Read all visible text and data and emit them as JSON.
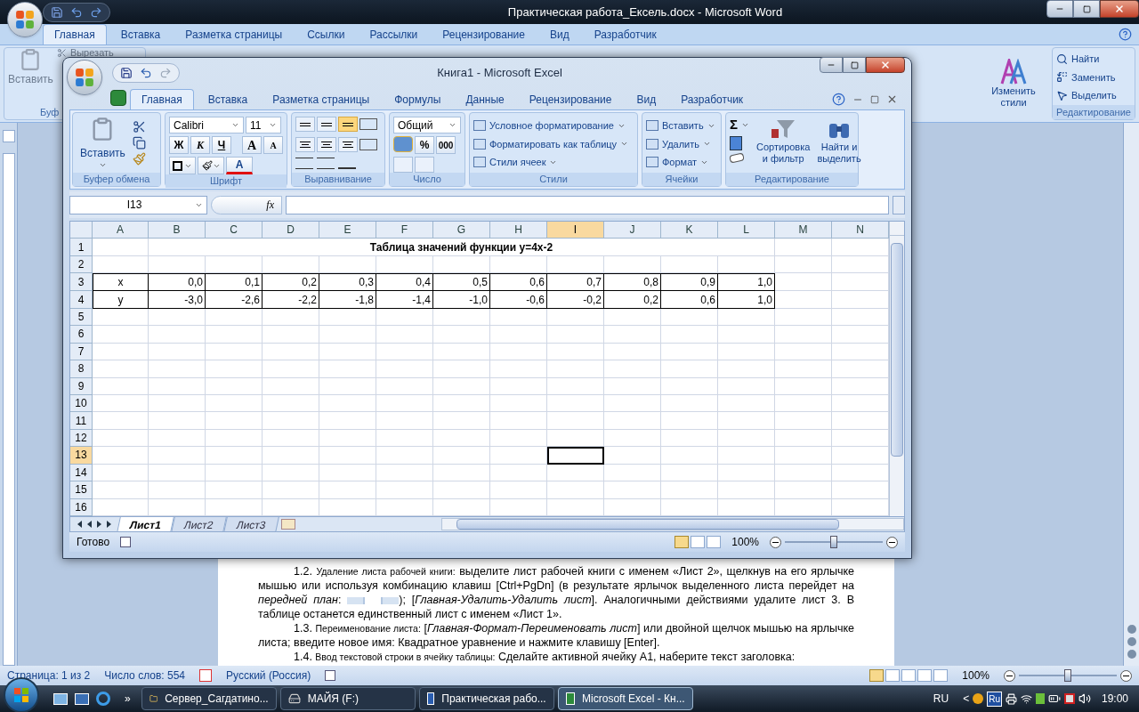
{
  "word": {
    "title": "Практическая работа_Ексель.docx - Microsoft Word",
    "tabs": [
      {
        "label": "Главная",
        "selected": true
      },
      {
        "label": "Вставка",
        "selected": false
      },
      {
        "label": "Разметка страницы",
        "selected": false
      },
      {
        "label": "Ссылки",
        "selected": false
      },
      {
        "label": "Рассылки",
        "selected": false
      },
      {
        "label": "Рецензирование",
        "selected": false
      },
      {
        "label": "Вид",
        "selected": false
      },
      {
        "label": "Разработчик",
        "selected": false
      }
    ],
    "ribbon": {
      "paste": "Вставить",
      "cut": "Вырезать",
      "clipboard_group": "Буф",
      "change_styles": [
        "Изменить",
        "стили"
      ],
      "editing": [
        "Найти",
        "Заменить",
        "Выделить"
      ],
      "editing_group": "Редактирование"
    },
    "paragraphs": [
      {
        "number": "1.2.",
        "heading": "Удаление листа рабочей книги:",
        "text": "выделите лист рабочей книги с именем «Лист 2», щелкнув на его ярлычке мышью или используя комбинацию клавиш [Ctrl+PgDn] (в результате ярлычок выделенного листа перейдет на *передней план*:",
        "text_after": "); [*Главная-Удалить-Удалить лист*]. Аналогичными действиями удалите лист 3. В таблице останется единственный лист с именем «Лист 1»."
      },
      {
        "number": "1.3.",
        "heading": "Переименование листа:",
        "text": "[*Главная-Формат-Переименовать лист*] или двойной щелчок мышью на ярлычке листа; введите новое имя: Квадратное уравнение и нажмите клавишу [Enter]."
      },
      {
        "number": "1.4.",
        "heading": "Ввод текстовой строки в ячейку таблицы:",
        "text": "Сделайте активной ячейку A1, наберите текст заголовка:"
      }
    ],
    "status": {
      "page": "Страница: 1 из 2",
      "words": "Число слов: 554",
      "language": "Русский (Россия)",
      "zoom": "100%",
      "zoom_level": {
        "level": 0.5
      }
    }
  },
  "excel": {
    "title": "Книга1 - Microsoft Excel",
    "tabs": [
      {
        "label": "Главная",
        "selected": true
      },
      {
        "label": "Вставка",
        "selected": false
      },
      {
        "label": "Разметка страницы",
        "selected": false
      },
      {
        "label": "Формулы",
        "selected": false
      },
      {
        "label": "Данные",
        "selected": false
      },
      {
        "label": "Рецензирование",
        "selected": false
      },
      {
        "label": "Вид",
        "selected": false
      },
      {
        "label": "Разработчик",
        "selected": false
      }
    ],
    "groups": [
      {
        "kind": "clipboard",
        "label": "Буфер обмена",
        "paste": "Вставить"
      },
      {
        "kind": "font",
        "label": "Шрифт",
        "font": "Calibri",
        "size": "11",
        "bold": "Ж",
        "italic": "К",
        "underline": "Ч",
        "grow": "A",
        "shrink": "A",
        "font_color_letter": "A"
      },
      {
        "kind": "align",
        "label": "Выравнивание",
        "vertical": [
          {
            "selected": false
          },
          {
            "selected": false
          },
          {
            "selected": true
          }
        ]
      },
      {
        "kind": "number",
        "label": "Число",
        "format": "Общий",
        "percent": "%",
        "thousands": "000"
      },
      {
        "kind": "styles",
        "label": "Стили",
        "items": [
          "Условное форматирование",
          "Форматировать как таблицу",
          "Стили ячеек"
        ]
      },
      {
        "kind": "cells",
        "label": "Ячейки",
        "items": [
          "Вставить",
          "Удалить",
          "Формат"
        ]
      },
      {
        "kind": "editing",
        "label": "Редактирование",
        "sum": "Σ",
        "sort": [
          "Сортировка",
          "и фильтр"
        ],
        "find": [
          "Найти и",
          "выделить"
        ]
      }
    ],
    "name_box": "I13",
    "fx": "fx",
    "columns": [
      {
        "label": "A",
        "selected": false
      },
      {
        "label": "B",
        "selected": false
      },
      {
        "label": "C",
        "selected": false
      },
      {
        "label": "D",
        "selected": false
      },
      {
        "label": "E",
        "selected": false
      },
      {
        "label": "F",
        "selected": false
      },
      {
        "label": "G",
        "selected": false
      },
      {
        "label": "H",
        "selected": false
      },
      {
        "label": "I",
        "selected": true
      },
      {
        "label": "J",
        "selected": false
      },
      {
        "label": "K",
        "selected": false
      },
      {
        "label": "L",
        "selected": false
      },
      {
        "label": "M",
        "selected": false
      },
      {
        "label": "N",
        "selected": false
      }
    ],
    "rows": [
      {
        "label": "1",
        "selected": false,
        "kind": "title",
        "title": "Таблица значений функции y=4x-2"
      },
      {
        "label": "2",
        "selected": false,
        "kind": "empty"
      },
      {
        "label": "3",
        "selected": false,
        "kind": "data",
        "cells": [
          "x",
          "0,0",
          "0,1",
          "0,2",
          "0,3",
          "0,4",
          "0,5",
          "0,6",
          "0,7",
          "0,8",
          "0,9",
          "1,0"
        ]
      },
      {
        "label": "4",
        "selected": false,
        "kind": "data",
        "cells": [
          "y",
          "-3,0",
          "-2,6",
          "-2,2",
          "-1,8",
          "-1,4",
          "-1,0",
          "-0,6",
          "-0,2",
          "0,2",
          "0,6",
          "1,0"
        ]
      },
      {
        "label": "5",
        "selected": false,
        "kind": "empty"
      },
      {
        "label": "6",
        "selected": false,
        "kind": "empty"
      },
      {
        "label": "7",
        "selected": false,
        "kind": "empty"
      },
      {
        "label": "8",
        "selected": false,
        "kind": "empty"
      },
      {
        "label": "9",
        "selected": false,
        "kind": "empty"
      },
      {
        "label": "10",
        "selected": false,
        "kind": "empty"
      },
      {
        "label": "11",
        "selected": false,
        "kind": "empty"
      },
      {
        "label": "12",
        "selected": false,
        "kind": "empty"
      },
      {
        "label": "13",
        "selected": true,
        "kind": "empty"
      },
      {
        "label": "14",
        "selected": false,
        "kind": "empty"
      },
      {
        "label": "15",
        "selected": false,
        "kind": "empty"
      },
      {
        "label": "16",
        "selected": false,
        "kind": "empty"
      }
    ],
    "sheets": [
      {
        "label": "Лист1",
        "selected": true
      },
      {
        "label": "Лист2",
        "selected": false
      },
      {
        "label": "Лист3",
        "selected": false
      }
    ],
    "status": "Готово",
    "zoom": "100%",
    "zoom_level": {
      "level": 0.5
    }
  },
  "taskbar": {
    "items": [
      {
        "label": "Сервер_Сагдатино...",
        "kind": "folder",
        "selected": false
      },
      {
        "label": "МАЙЯ (F:)",
        "kind": "drive",
        "selected": false
      },
      {
        "label": "Практическая рабо...",
        "kind": "word",
        "selected": false
      },
      {
        "label": "Microsoft Excel - Кн...",
        "kind": "excel",
        "selected": true
      }
    ],
    "more": "»",
    "language": "RU",
    "tray_expand": "<",
    "lang_badge": "Ru",
    "clock": "19:00"
  }
}
